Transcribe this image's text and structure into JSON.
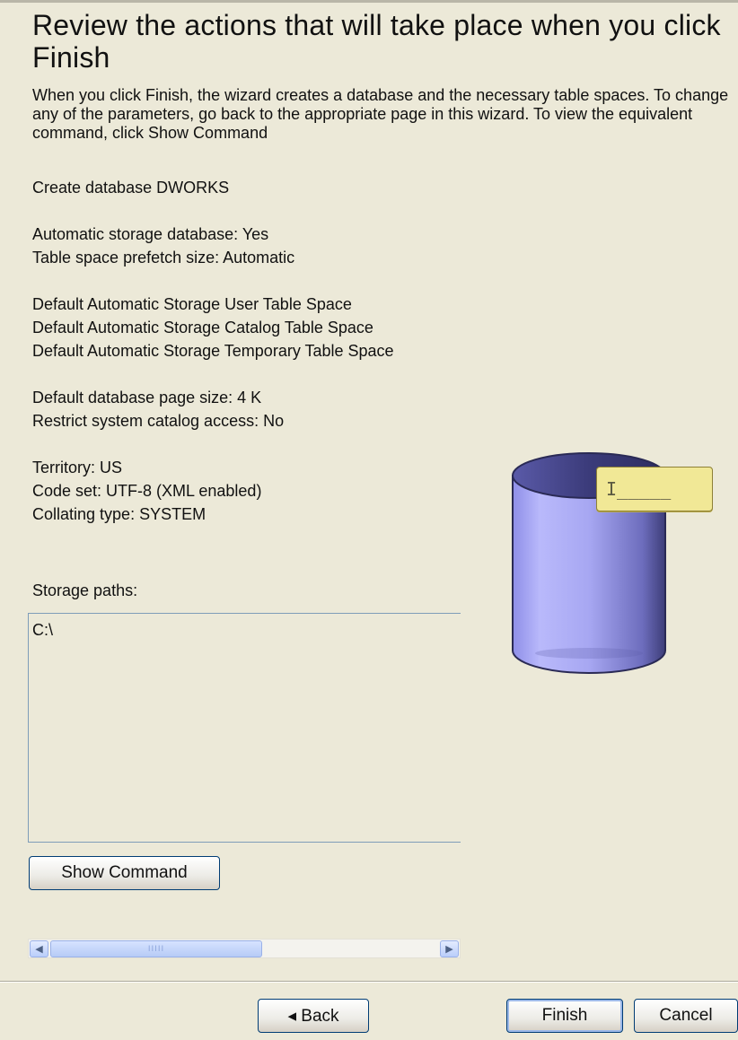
{
  "header": {
    "title": "Review the actions that will take place when you click Finish",
    "description": "When you click Finish, the wizard creates a database and the necessary table spaces. To change any of the parameters, go back to the appropriate page in this wizard. To view the equivalent command, click Show Command"
  },
  "summary": {
    "create": "Create database DWORKS",
    "automatic_storage": "Automatic storage database: Yes",
    "prefetch": "Table space prefetch size: Automatic",
    "user_ts": "Default Automatic Storage User Table Space",
    "catalog_ts": "Default Automatic Storage Catalog Table Space",
    "temp_ts": "Default Automatic Storage Temporary Table Space",
    "page_size": "Default database page size: 4 K",
    "restrict_catalog": "Restrict system catalog access: No",
    "territory": "Territory: US",
    "code_set": "Code set: UTF-8 (XML enabled)",
    "collating": "Collating type: SYSTEM"
  },
  "storage": {
    "label": "Storage paths:",
    "paths": [
      "C:\\"
    ]
  },
  "buttons": {
    "show_command": "Show Command",
    "back": "◂ Back",
    "finish": "Finish",
    "cancel": "Cancel"
  },
  "scrollbar": {
    "left_icon": "scroll-left-arrow-icon",
    "right_icon": "scroll-right-arrow-icon",
    "grip": "IIIII"
  },
  "illustration": {
    "icon": "database-cylinder-icon",
    "tooltip_text": "I_____",
    "cylinder_color": "#a9a9f2"
  }
}
